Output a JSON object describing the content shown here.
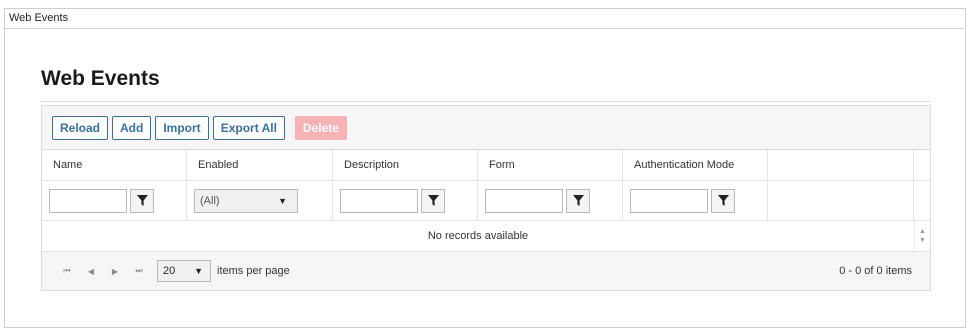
{
  "window": {
    "title": "Web Events"
  },
  "page": {
    "title": "Web Events"
  },
  "toolbar": {
    "reload": "Reload",
    "add": "Add",
    "import": "Import",
    "export_all": "Export All",
    "delete": "Delete"
  },
  "grid": {
    "columns": [
      "Name",
      "Enabled",
      "Description",
      "Form",
      "Authentication Mode"
    ],
    "enabled_filter": "(All)",
    "empty_message": "No records available"
  },
  "pager": {
    "first": "⏮",
    "prev": "◀",
    "next": "▶",
    "last": "⏭",
    "page_size": "20",
    "items_per_page_label": "items per page",
    "info": "0 - 0 of 0 items"
  },
  "icons": {
    "filter": "filter-icon",
    "dropdown": "caret-down-icon",
    "scroll_up": "scroll-up-icon",
    "scroll_down": "scroll-down-icon"
  },
  "colors": {
    "accent": "#3a6fa5",
    "delete_disabled": "#f7b3b3"
  }
}
